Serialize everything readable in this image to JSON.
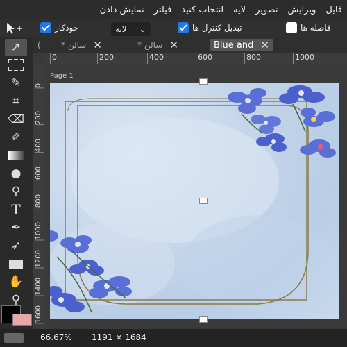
{
  "menu": {
    "items": [
      "فایل",
      "ویرایش",
      "تصویر",
      "لایه",
      "انتخاب کنید",
      "فیلتر",
      "نمایش دادن"
    ]
  },
  "options": {
    "autoselect_label": "خودکار",
    "autoselect_checked": true,
    "layer_select_value": "لایه",
    "transform_label": "تبدیل کنترل ها",
    "transform_checked": true,
    "spacing_label": "فاصله ها",
    "spacing_checked": false
  },
  "tabs": [
    {
      "label": "* سالن",
      "active": false
    },
    {
      "label": "* سالن",
      "active": false
    },
    {
      "label": "Blue and",
      "active": true
    }
  ],
  "ruler": {
    "horizontal": [
      "0",
      "200",
      "400",
      "600",
      "800",
      "1000"
    ],
    "vertical": [
      "0",
      "200",
      "400",
      "600",
      "800",
      "1000",
      "1200",
      "1400",
      "1600"
    ]
  },
  "page_label": "Page 1",
  "status": {
    "zoom": "66.67%",
    "size": "1191 × 1684"
  },
  "colors": {
    "foreground": "#000000",
    "background": "#e8a8a8",
    "accent": "#1e78f0"
  }
}
